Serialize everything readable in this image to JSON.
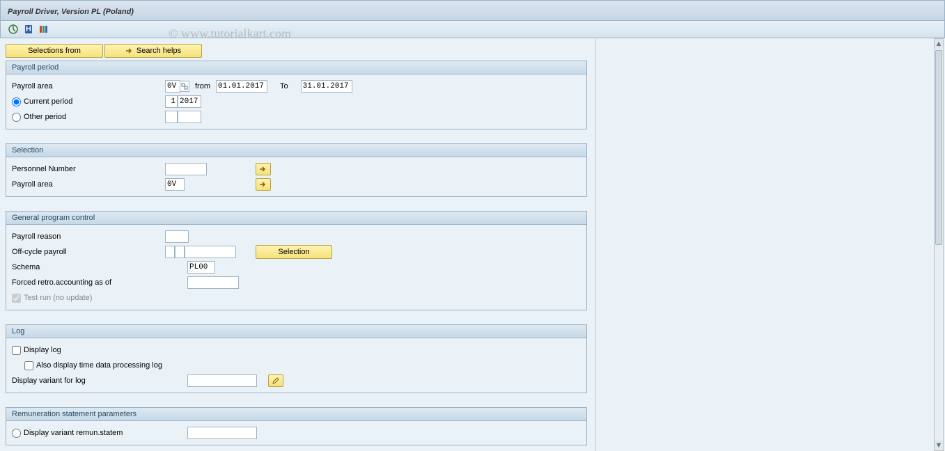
{
  "watermark": "© www.tutorialkart.com",
  "title": "Payroll Driver, Version PL (Poland)",
  "buttons": {
    "selections_from": "Selections from",
    "search_helps": "Search helps",
    "selection": "Selection"
  },
  "groups": {
    "payroll_period": {
      "title": "Payroll period",
      "payroll_area_label": "Payroll area",
      "payroll_area_value": "0V",
      "from_label": "from",
      "from_value": "01.01.2017",
      "to_label": "To",
      "to_value": "31.01.2017",
      "current_period_label": "Current period",
      "current_period_num": "1",
      "current_period_year": "2017",
      "other_period_label": "Other period",
      "other_period_num": "",
      "other_period_year": ""
    },
    "selection": {
      "title": "Selection",
      "personnel_number_label": "Personnel Number",
      "personnel_number_value": "",
      "payroll_area_label": "Payroll area",
      "payroll_area_value": "0V"
    },
    "general": {
      "title": "General program control",
      "payroll_reason_label": "Payroll reason",
      "payroll_reason_value": "",
      "offcycle_label": "Off-cycle payroll",
      "offcycle_a": "",
      "offcycle_b": "",
      "offcycle_c": "",
      "schema_label": "Schema",
      "schema_value": "PL00",
      "forced_retro_label": "Forced retro.accounting as of",
      "forced_retro_value": "",
      "test_run_label": "Test run (no update)"
    },
    "log": {
      "title": "Log",
      "display_log_label": "Display log",
      "also_display_label": "Also display time data processing log",
      "display_variant_label": "Display variant for log",
      "display_variant_value": ""
    },
    "remuneration": {
      "title": "Remuneration statement parameters",
      "display_variant_remun_label": "Display variant remun.statem",
      "display_variant_remun_value": ""
    }
  }
}
